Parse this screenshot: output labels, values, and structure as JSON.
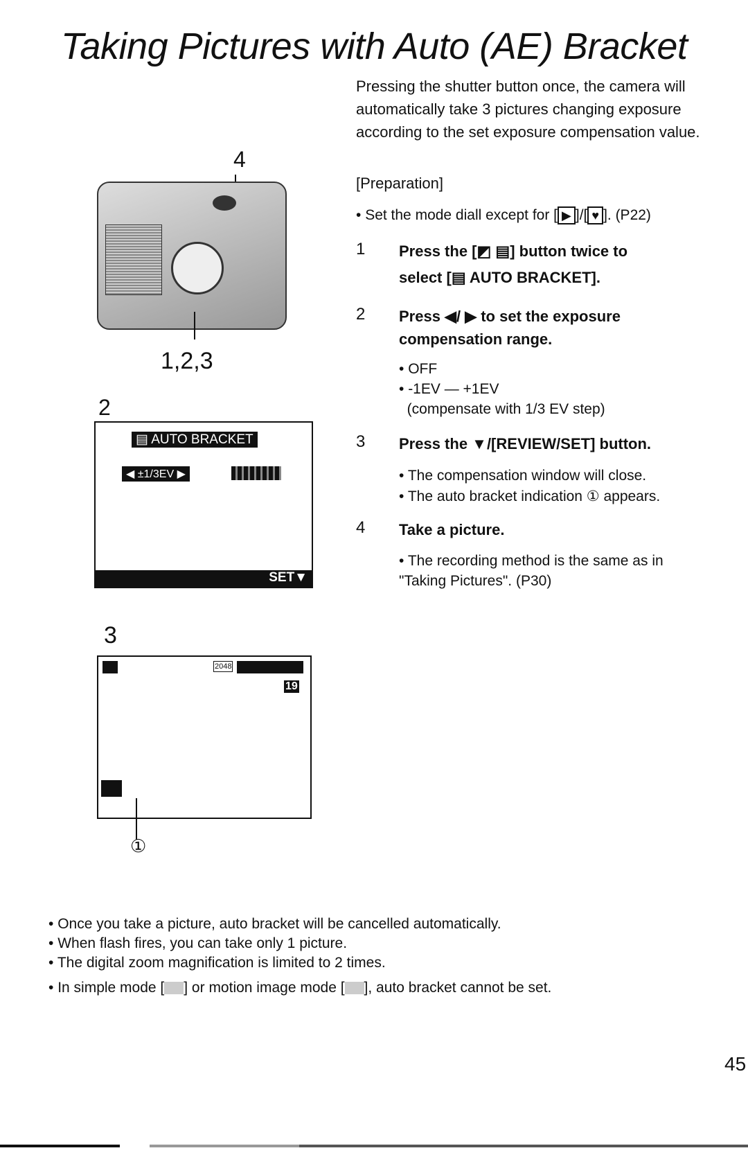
{
  "title": "Taking Pictures with Auto (AE) Bracket",
  "intro": "Pressing the shutter button once, the camera will automatically take 3 pictures changing exposure according to the set exposure compensation value.",
  "preparation": {
    "label": "[Preparation]",
    "bullet_pre": "Set the mode diall except for [",
    "bullet_mid": "]/[",
    "bullet_post": "]. (P22)"
  },
  "steps": [
    {
      "num": "1",
      "line1": "Press the [",
      "line1b": "] button twice to",
      "line2a": "select [",
      "line2b": "AUTO BRACKET]."
    },
    {
      "num": "2",
      "text": "Press ◀/ ▶ to set the exposure compensation range.",
      "bullets": [
        "OFF",
        "-1EV — +1EV"
      ],
      "note": "(compensate with 1/3 EV step)"
    },
    {
      "num": "3",
      "text": "Press the ▼/[REVIEW/SET] button.",
      "bullets": [
        "The compensation window will close.",
        "The auto bracket indication ① appears."
      ]
    },
    {
      "num": "4",
      "text": "Take a picture.",
      "bullets": [
        "The recording method is the same as in \"Taking Pictures\". (P30)"
      ]
    }
  ],
  "figures": {
    "camera_callout_top": "4",
    "camera_callout_bottom": "1,2,3",
    "screen2": {
      "label": "2",
      "header": "AUTO BRACKET",
      "value": "◀ ±1/3EV ▶",
      "footer": "SET▼"
    },
    "screen3": {
      "label": "3",
      "resolution": "2048",
      "count": "19",
      "callout": "①"
    }
  },
  "notes": [
    "Once you take a picture, auto bracket will be cancelled automatically.",
    "When flash fires, you can take only 1 picture.",
    "The digital zoom magnification is limited to 2 times."
  ],
  "note_last": {
    "pre": "In simple mode [",
    "mid": "] or motion image mode [",
    "post": "], auto bracket cannot be set."
  },
  "page_number": "45"
}
